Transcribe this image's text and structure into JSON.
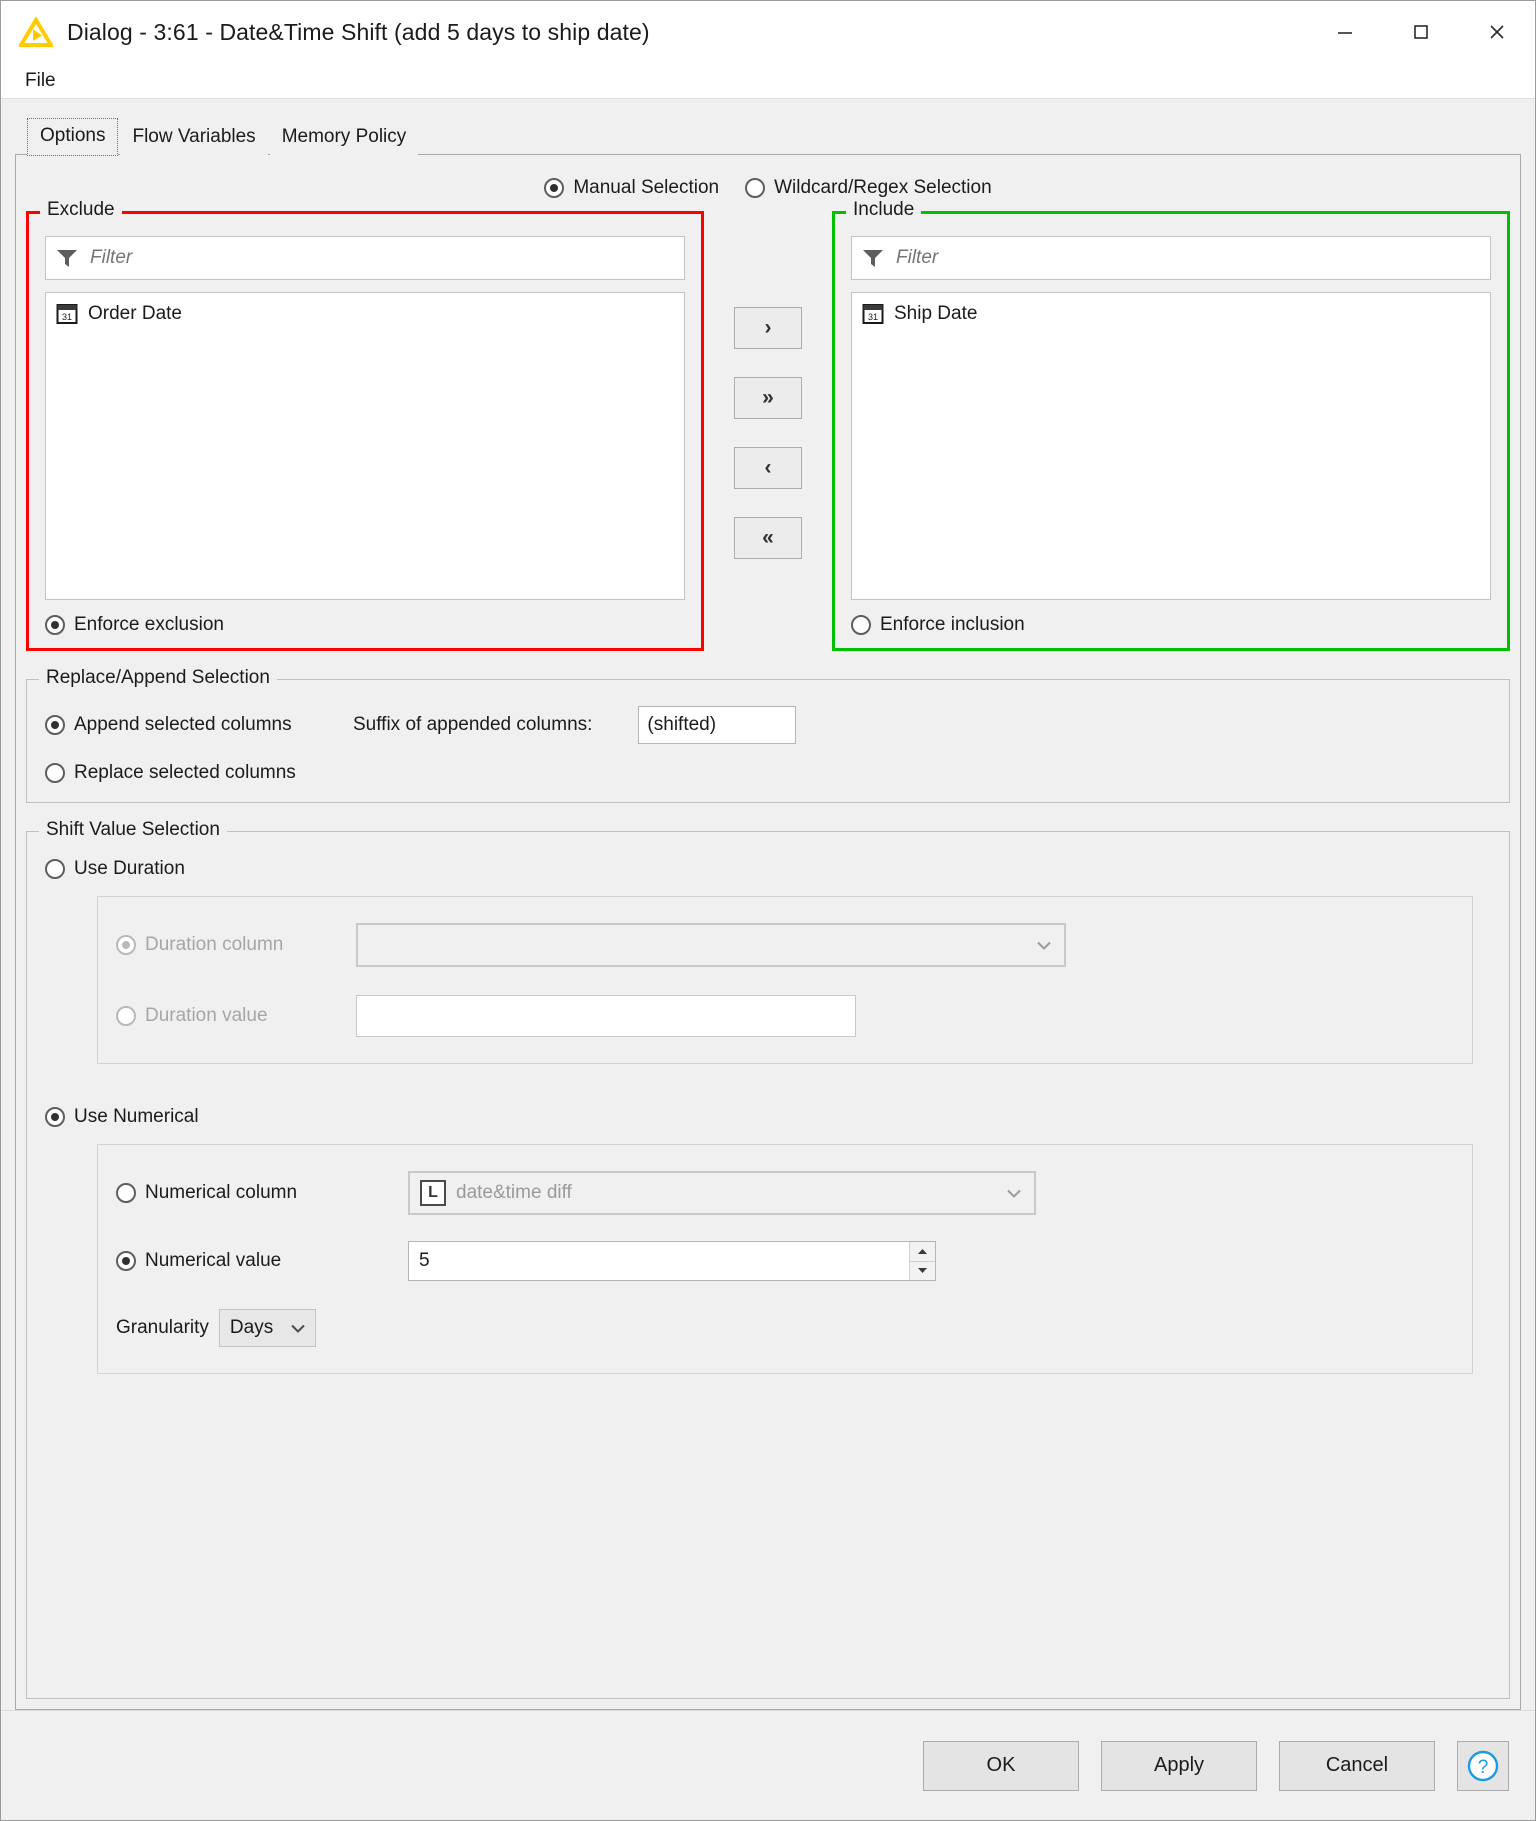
{
  "window": {
    "title": "Dialog - 3:61 - Date&Time Shift (add 5 days to ship date)",
    "minimize_label": "—",
    "maximize_label": "□",
    "close_label": "✕",
    "app_icon": "knime-triangle-icon"
  },
  "menubar": {
    "items": [
      {
        "label": "File"
      }
    ]
  },
  "tabs": [
    {
      "label": "Options",
      "active": true
    },
    {
      "label": "Flow Variables",
      "active": false
    },
    {
      "label": "Memory Policy",
      "active": false
    }
  ],
  "selection_mode": {
    "manual_label": "Manual Selection",
    "wildcard_label": "Wildcard/Regex Selection",
    "selected": "Manual Selection"
  },
  "exclude": {
    "legend": "Exclude",
    "border_color": "#ff0000",
    "filter_placeholder": "Filter",
    "filter_value": "",
    "items": [
      {
        "label": "Order Date",
        "type_icon": "calendar-icon",
        "icon_text": "31"
      }
    ],
    "enforce_label": "Enforce exclusion",
    "enforce_checked": true
  },
  "include": {
    "legend": "Include",
    "border_color": "#00c000",
    "filter_placeholder": "Filter",
    "filter_value": "",
    "items": [
      {
        "label": "Ship Date",
        "type_icon": "calendar-icon",
        "icon_text": "31"
      }
    ],
    "enforce_label": "Enforce inclusion",
    "enforce_checked": false
  },
  "transfer_buttons": [
    {
      "name": "move-right",
      "label": "›"
    },
    {
      "name": "move-all-right",
      "label": "»"
    },
    {
      "name": "move-left",
      "label": "‹"
    },
    {
      "name": "move-all-left",
      "label": "«"
    }
  ],
  "replace_append": {
    "legend": "Replace/Append Selection",
    "append_label": "Append selected columns",
    "replace_label": "Replace selected columns",
    "selected": "Append selected columns",
    "suffix_label": "Suffix of appended columns:",
    "suffix_value": "(shifted)"
  },
  "shift_value": {
    "legend": "Shift Value Selection",
    "use_duration_label": "Use Duration",
    "use_duration_checked": false,
    "duration_column_label": "Duration column",
    "duration_column_checked": true,
    "duration_column_value": "",
    "duration_value_label": "Duration value",
    "duration_value_checked": false,
    "duration_value_text": "",
    "use_numerical_label": "Use Numerical",
    "use_numerical_checked": true,
    "numerical_column_label": "Numerical column",
    "numerical_column_checked": false,
    "numerical_column_value": "date&time diff",
    "numerical_column_type_icon": "long-type-icon",
    "numerical_column_type_letter": "L",
    "numerical_value_label": "Numerical value",
    "numerical_value_checked": true,
    "numerical_value_text": "5",
    "granularity_label": "Granularity",
    "granularity_value": "Days"
  },
  "footer": {
    "ok_label": "OK",
    "apply_label": "Apply",
    "cancel_label": "Cancel",
    "help_label": "?"
  }
}
